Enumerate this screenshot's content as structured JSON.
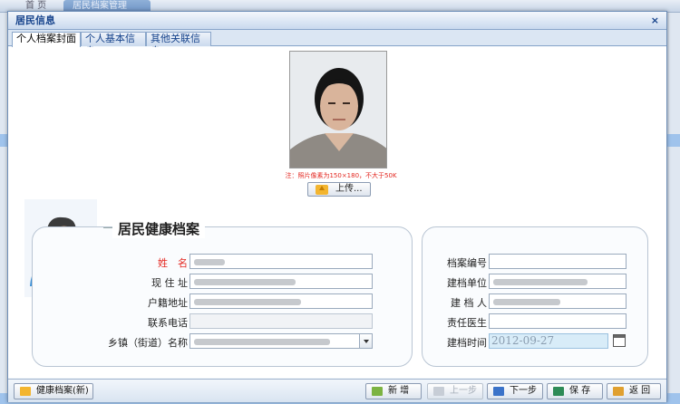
{
  "background": {
    "tabs": [
      "首 页",
      "居民档案管理"
    ]
  },
  "window": {
    "title": "居民信息",
    "close_symbol": "×",
    "tabs": [
      {
        "label": "个人档案封面",
        "active": true
      },
      {
        "label": "个人基本信息",
        "active": false
      },
      {
        "label": "其他关联信息",
        "active": false
      }
    ]
  },
  "photo": {
    "note": "注：照片像素为150×180，不大于50K",
    "upload_label": "上传..."
  },
  "section": {
    "title": "居民健康档案"
  },
  "left_fields": {
    "name_label": "姓　名",
    "address_label": "现 住 址",
    "household_label": "户籍地址",
    "phone_label": "联系电话",
    "town_label": "乡镇（街道）名称"
  },
  "right_fields": {
    "file_no_label": "档案编号",
    "unit_label": "建档单位",
    "creator_label": "建 档 人",
    "doctor_label": "责任医生",
    "date_label": "建档时间",
    "date_value": "2012-09-27"
  },
  "footer": {
    "health_file_label": "健康档案(新)",
    "new_label": "新 增",
    "prev_label": "上一步",
    "next_label": "下一步",
    "save_label": "保 存",
    "back_label": "返 回"
  },
  "colors": {
    "title_text": "#15428b",
    "required_label": "#e3261f",
    "date_field_bg": "#d8ecf8"
  }
}
